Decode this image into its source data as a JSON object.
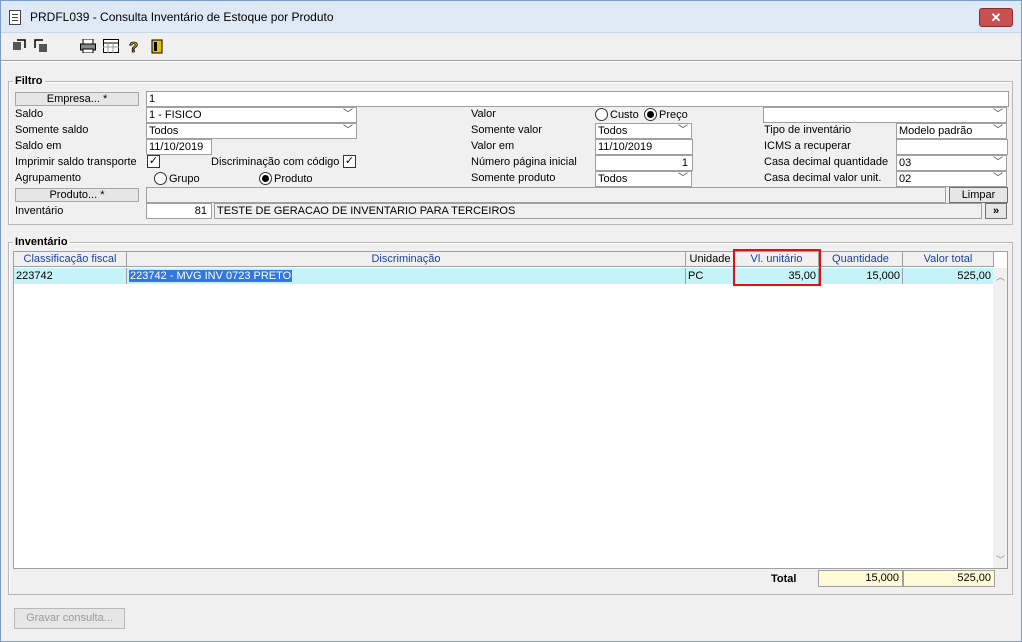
{
  "window": {
    "title": "PRDFL039 - Consulta Inventário de Estoque por Produto",
    "close_label": "✕"
  },
  "toolbar": {
    "icons": [
      "back-icon",
      "forward-icon",
      "print-icon",
      "grid-icon",
      "help-icon",
      "exit-icon"
    ]
  },
  "filtro": {
    "title": "Filtro",
    "empresa_btn": "Empresa... *",
    "empresa_value": "1",
    "saldo_label": "Saldo",
    "saldo_value": "1 - FISICO",
    "somente_saldo_label": "Somente saldo",
    "somente_saldo_value": "Todos",
    "saldo_em_label": "Saldo em",
    "saldo_em_value": "11/10/2019",
    "imprimir_label": "Imprimir saldo transporte",
    "discriminacao_codigo_label": "Discriminação com código",
    "agrupamento_label": "Agrupamento",
    "grupo_label": "Grupo",
    "produto_radio_label": "Produto",
    "produto_btn": "Produto... *",
    "inventario_label": "Inventário",
    "inventario_num": "81",
    "inventario_desc": "TESTE DE GERACAO DE INVENTARIO PARA TERCEIROS",
    "valor_label": "Valor",
    "custo_label": "Custo",
    "preco_label": "Preço",
    "somente_valor_label": "Somente valor",
    "somente_valor_value": "Todos",
    "valor_em_label": "Valor em",
    "valor_em_value": "11/10/2019",
    "num_pagina_label": "Número página inicial",
    "num_pagina_value": "1",
    "somente_produto_label": "Somente produto",
    "somente_produto_value": "Todos",
    "tipo_inventario_label": "Tipo de inventário",
    "tipo_inventario_value": "Modelo padrão",
    "icms_label": "ICMS a recuperar",
    "casa_qtd_label": "Casa decimal quantidade",
    "casa_qtd_value": "03",
    "casa_valor_label": "Casa decimal valor unit.",
    "casa_valor_value": "02",
    "limpar_btn": "Limpar",
    "more_btn": "»"
  },
  "inventario": {
    "title": "Inventário",
    "columns": [
      "Classificação fiscal",
      "Discriminação",
      "Unidade",
      "Vl. unitário",
      "Quantidade",
      "Valor total"
    ],
    "rows": [
      {
        "classificacao": "223742",
        "discriminacao": "223742 - MVG INV 0723 PRETO",
        "unidade": "PC",
        "vl_unitario": "35,00",
        "quantidade": "15,000",
        "valor_total": "525,00"
      }
    ],
    "total_label": "Total",
    "total_quantidade": "15,000",
    "total_valor": "525,00"
  },
  "footer": {
    "gravar_btn": "Gravar consulta..."
  },
  "colors": {
    "row_selected": "#c6f3fa",
    "header_text": "#1a3fa0",
    "total_bg": "#fffbd6",
    "highlight_border": "#e01010"
  }
}
